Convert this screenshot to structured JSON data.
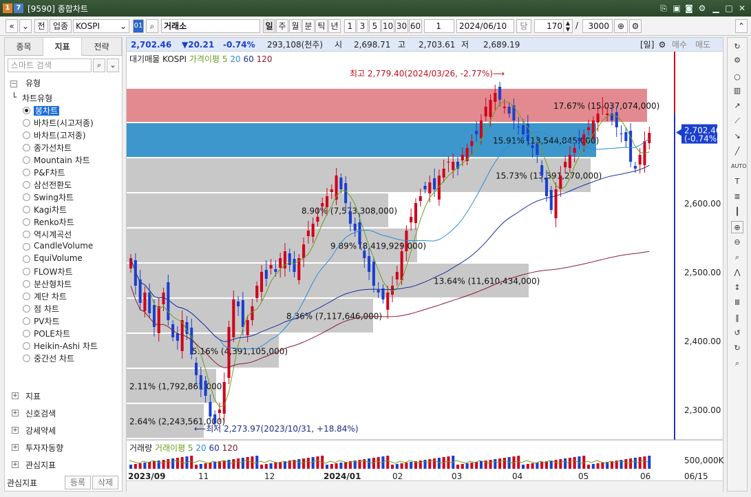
{
  "window": {
    "code_badge": "1",
    "code_badge2": "7",
    "title": "[9590] 종합차트"
  },
  "toolbar": {
    "nav_prev": "«",
    "nav_down": "»",
    "btn_jeon": "전",
    "field_type": "업종",
    "market_value": "KOSPI",
    "code_value": "01",
    "symbol_value": "거래소",
    "periods": [
      "일",
      "주",
      "월",
      "분",
      "틱",
      "년"
    ],
    "active_period": "일",
    "intervals": [
      "1",
      "3",
      "5",
      "10",
      "30",
      "60"
    ],
    "unit_value": "1",
    "date_value": "2024/06/10",
    "date_suffix": "당",
    "count_value": "170",
    "slash": "/",
    "max_value": "3000"
  },
  "left_panel": {
    "tabs": [
      "종목",
      "지표",
      "전략"
    ],
    "active_tab": "지표",
    "search_placeholder": "스마트 검색",
    "group_title": "유형",
    "subgroup": "차트유형",
    "chart_types": [
      "봉차트",
      "바차트(시고저종)",
      "바차트(고저종)",
      "종가선차트",
      "Mountain 차트",
      "P&F차트",
      "삼선전환도",
      "Swing차트",
      "Kagi차트",
      "Renko차트",
      "역시계곡선",
      "CandleVolume",
      "EquiVolume",
      "FLOW차트",
      "분산형차트",
      "계단 차트",
      "점 차트",
      "PV차트",
      "POLE차트",
      "Heikin-Ashi 차트",
      "중간선 차트"
    ],
    "selected_type": "봉차트",
    "sections": [
      "지표",
      "신호검색",
      "강세약세",
      "투자자동향",
      "관심지표"
    ],
    "footer_label": "관심지표",
    "footer_btn1": "등록",
    "footer_btn2": "삭제"
  },
  "info_bar": {
    "price": "2,702.46",
    "change": "▼20.21",
    "pct": "-0.74%",
    "volume": "293,108(천주)",
    "open_label": "시",
    "open": "2,698.71",
    "high_label": "고",
    "high": "2,703.61",
    "low_label": "저",
    "low": "2,689.19",
    "period_badge": "[일]",
    "buy_btn": "매수",
    "sell_btn": "매도"
  },
  "legend": {
    "name1": "대기매물",
    "name2": "KOSPI",
    "ma_label": "가격이평 5",
    "ma20": "20",
    "ma60": "60",
    "ma120": "120"
  },
  "vol_legend": {
    "name": "거래량",
    "ma_label": "거래이평 5",
    "ma20": "20",
    "ma60": "60",
    "ma120": "120",
    "axis_label": "500,000K"
  },
  "annotations": {
    "high": "최고 2,779.40(2024/03/26, -2.77%)⟶",
    "low": "⟵최저 2,273.97(2023/10/31, +18.84%)"
  },
  "price_axis": {
    "ticks": [
      "2,600.00",
      "2,500.00",
      "2,400.00",
      "2,300.00"
    ],
    "current": "2,702.46",
    "current_pct": "(-0.74%)"
  },
  "x_axis": {
    "labels": [
      "2023/09",
      "11",
      "12",
      "2024/01",
      "02",
      "03",
      "04",
      "05",
      "06"
    ],
    "last_date": "06/15"
  },
  "colors": {
    "up": "#d0021b",
    "down": "#1a3fcf",
    "ma5": "#6a9f1c",
    "ma20": "#2a8ed8",
    "ma60": "#1b2f9c",
    "ma120": "#8a1a2e",
    "supply_high": "#e28a8f",
    "supply_mid": "#3d97cc",
    "supply_low": "#c8c8c8"
  },
  "chart_data": {
    "type": "candlestick",
    "ylim": [
      2260,
      2820
    ],
    "supply_zones": [
      {
        "low": 2717,
        "high": 2767,
        "pct": "17.67%",
        "volume": "15,037,074,000"
      },
      {
        "low": 2666,
        "high": 2717,
        "pct": "15.91%",
        "volume": "13,544,845,000"
      },
      {
        "low": 2615,
        "high": 2666,
        "pct": "15.73%",
        "volume": "13,391,270,000"
      },
      {
        "low": 2564,
        "high": 2615,
        "pct": "8.90%",
        "volume": "7,573,308,000"
      },
      {
        "low": 2513,
        "high": 2564,
        "pct": "9.89%",
        "volume": "8,419,929,000"
      },
      {
        "low": 2462,
        "high": 2513,
        "pct": "13.64%",
        "volume": "11,610,434,000"
      },
      {
        "low": 2411,
        "high": 2462,
        "pct": "8.36%",
        "volume": "7,117,646,000"
      },
      {
        "low": 2360,
        "high": 2411,
        "pct": "5.16%",
        "volume": "4,391,105,000"
      },
      {
        "low": 2309,
        "high": 2360,
        "pct": "2.11%",
        "volume": "1,792,861,000"
      },
      {
        "low": 2258,
        "high": 2309,
        "pct": "2.64%",
        "volume": "2,243,561,000"
      }
    ],
    "close_path": [
      2520,
      2480,
      2455,
      2470,
      2440,
      2420,
      2450,
      2470,
      2430,
      2405,
      2400,
      2430,
      2410,
      2380,
      2350,
      2330,
      2320,
      2290,
      2280,
      2300,
      2340,
      2420,
      2460,
      2450,
      2420,
      2430,
      2450,
      2480,
      2500,
      2490,
      2510,
      2500,
      2520,
      2530,
      2510,
      2500,
      2520,
      2540,
      2560,
      2570,
      2580,
      2600,
      2610,
      2620,
      2640,
      2620,
      2600,
      2570,
      2560,
      2540,
      2520,
      2500,
      2480,
      2470,
      2460,
      2470,
      2480,
      2500,
      2530,
      2560,
      2580,
      2600,
      2610,
      2620,
      2630,
      2620,
      2640,
      2650,
      2660,
      2660,
      2650,
      2670,
      2680,
      2690,
      2700,
      2720,
      2740,
      2750,
      2760,
      2750,
      2740,
      2730,
      2720,
      2710,
      2700,
      2690,
      2680,
      2670,
      2640,
      2610,
      2590,
      2620,
      2640,
      2660,
      2670,
      2680,
      2690,
      2700,
      2710,
      2720,
      2730,
      2740,
      2730,
      2720,
      2710,
      2700,
      2690,
      2660,
      2650,
      2670,
      2690,
      2702
    ]
  }
}
